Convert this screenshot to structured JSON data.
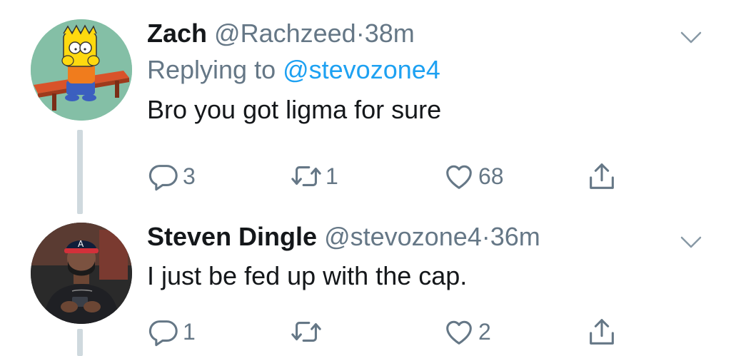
{
  "tweets": [
    {
      "display_name": "Zach",
      "handle": "@Rachzeed",
      "separator": "·",
      "time": "38m",
      "replying_prefix": "Replying to ",
      "replying_handle": "@stevozone4",
      "text": "Bro you got ligma for sure",
      "counts": {
        "reply": "3",
        "retweet": "1",
        "like": "68"
      }
    },
    {
      "display_name": "Steven Dingle",
      "handle": "@stevozone4",
      "separator": "·",
      "time": "36m",
      "text": "I just be fed up with the cap.",
      "counts": {
        "reply": "1",
        "retweet": "",
        "like": "2"
      }
    }
  ],
  "icons": {
    "reply": "reply-icon",
    "retweet": "retweet-icon",
    "like": "heart-icon",
    "share": "share-icon",
    "menu": "chevron-down-icon"
  },
  "colors": {
    "text": "#14171a",
    "secondary": "#657786",
    "link": "#1da1f2",
    "thread_line": "#cfd9de"
  }
}
